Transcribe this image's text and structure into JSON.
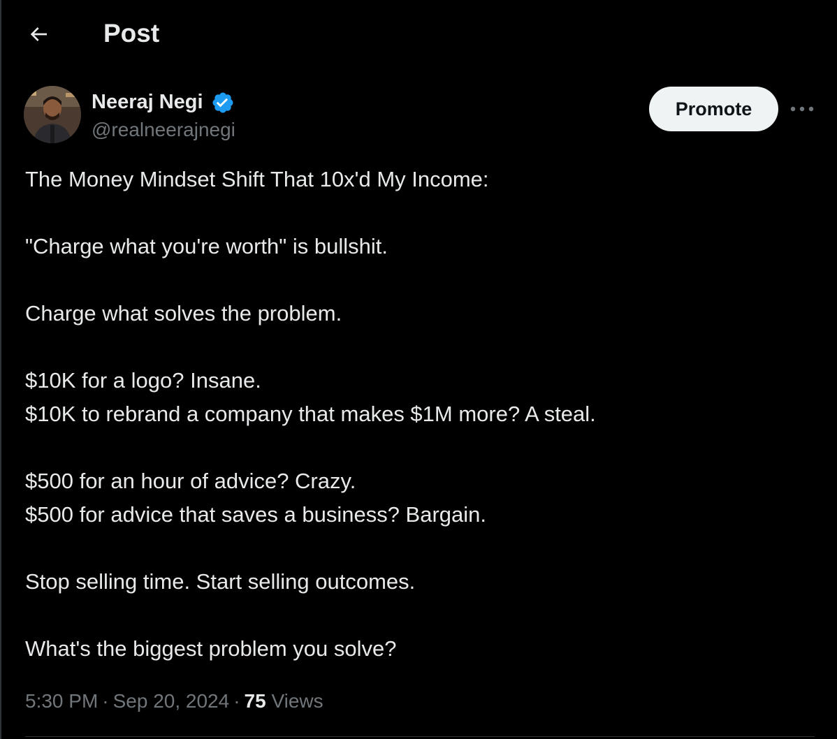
{
  "header": {
    "title": "Post",
    "back_icon": "arrow-left-icon"
  },
  "author": {
    "name": "Neeraj Negi",
    "handle": "@realneerajnegi",
    "verified_icon": "verified-badge-icon",
    "verified_color": "#1d9bf0"
  },
  "actions": {
    "promote_label": "Promote",
    "more_icon": "more-horizontal-icon"
  },
  "post": {
    "lines": [
      "The Money Mindset Shift That 10x'd My Income:",
      "",
      "\"Charge what you're worth\" is bullshit.",
      "",
      "Charge what solves the problem.",
      "",
      "$10K for a logo? Insane.",
      "$10K to rebrand a company that makes $1M more? A steal.",
      "",
      "$500 for an hour of advice? Crazy.",
      "$500 for advice that saves a business? Bargain.",
      "",
      "Stop selling time. Start selling outcomes.",
      "",
      "What's the biggest problem you solve?"
    ]
  },
  "meta": {
    "time": "5:30 PM",
    "date": "Sep 20, 2024",
    "views_count": "75",
    "views_label": "Views"
  },
  "colors": {
    "background": "#000000",
    "text_primary": "#e7e9ea",
    "text_secondary": "#71767b",
    "button_bg": "#eff3f4",
    "border": "#2f3336"
  }
}
